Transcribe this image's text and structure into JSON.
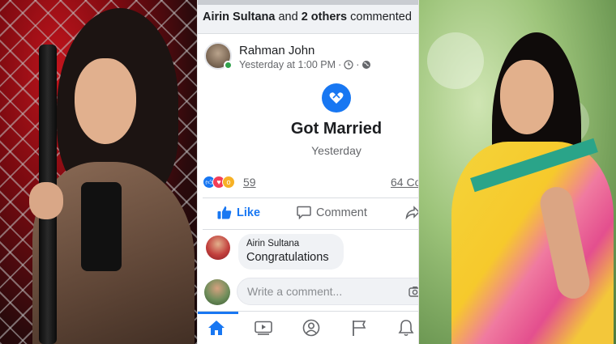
{
  "notification": {
    "actor": "Airin Sultana",
    "connector": " and ",
    "others": "2 others",
    "action": " commented"
  },
  "post": {
    "author": "Rahman John",
    "timestamp": "Yesterday at 1:00 PM",
    "meta_separator": "·",
    "event_title": "Got Married",
    "event_subtitle": "Yesterday",
    "reaction_count": "59",
    "comment_count": "64 Co"
  },
  "actions": {
    "like_label": "Like",
    "comment_label": "Comment"
  },
  "comments": [
    {
      "name": "Airin Sultana",
      "text": "Congratulations"
    }
  ],
  "composer": {
    "placeholder": "Write a comment..."
  },
  "tabs": [
    "home",
    "watch",
    "profile",
    "pages",
    "notifications"
  ],
  "colors": {
    "facebook_blue": "#1877f2",
    "text_primary": "#1c1e21",
    "text_secondary": "#65676b",
    "bubble_bg": "#f0f2f5",
    "online_green": "#31a24c"
  },
  "icons": {
    "clock": "clock-icon",
    "globe": "globe-icon",
    "event": "heart-event-icon",
    "like": "thumbs-up-icon",
    "comment": "comment-bubble-icon",
    "share": "share-arrow-icon",
    "camera": "camera-icon"
  }
}
